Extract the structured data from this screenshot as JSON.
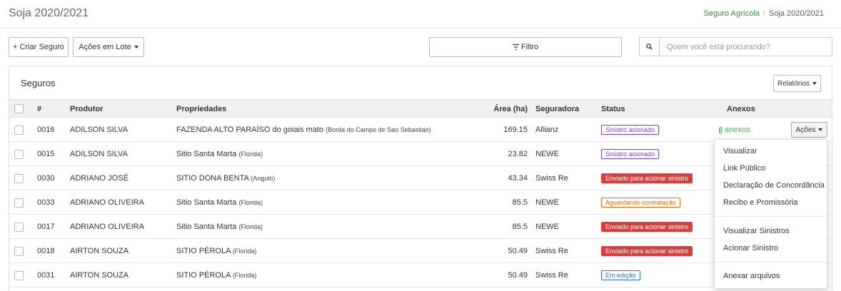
{
  "header": {
    "title": "Soja 2020/2021",
    "breadcrumb": {
      "link": "Seguro Agrícola",
      "separator": "/",
      "current": "Soja 2020/2021"
    }
  },
  "toolbar": {
    "create_label": "+ Criar Seguro",
    "bulk_label": "Ações em Lote",
    "filter_label": "Filtro",
    "search_placeholder": "Quem você está procurando?"
  },
  "panel": {
    "title": "Seguros",
    "reports_label": "Relatórios"
  },
  "table": {
    "columns": {
      "id": "#",
      "producer": "Produtor",
      "properties": "Propriedades",
      "area": "Área (ha)",
      "insurer": "Seguradora",
      "status": "Status",
      "attachments": "Anexos"
    },
    "rows": [
      {
        "id": "0016",
        "producer": "ADILSON SILVA",
        "property": "FAZENDA ALTO PARAÍSO do goiais mato",
        "property_sub": "(Borda do Campo de Sao Sebastiao)",
        "area": "169.15",
        "insurer": "Allianz",
        "status": "Sinistro acionado",
        "status_color": "#7b3fb6",
        "attachments": "anexos",
        "actions": "Ações"
      },
      {
        "id": "0015",
        "producer": "ADILSON SILVA",
        "property": "Sitio Santa Marta",
        "property_sub": "(Florida)",
        "area": "23.82",
        "insurer": "NEWE",
        "status": "Sinistro acionado",
        "status_color": "#7b3fb6"
      },
      {
        "id": "0030",
        "producer": "ADRIANO JOSÉ",
        "property": "SITIO DONA BENTA",
        "property_sub": "(Angulo)",
        "area": "43.34",
        "insurer": "Swiss Re",
        "status": "Enviado para acionar sinistro",
        "status_color": "#dc3c3c"
      },
      {
        "id": "0033",
        "producer": "ADRIANO OLIVEIRA",
        "property": "Sitio Santa Marta",
        "property_sub": "(Florida)",
        "area": "85.5",
        "insurer": "NEWE",
        "status": "Aguardando contratação",
        "status_color": "#e06c10"
      },
      {
        "id": "0017",
        "producer": "ADRIANO OLIVEIRA",
        "property": "Sitio Santa Marta",
        "property_sub": "(Florida)",
        "area": "85.5",
        "insurer": "NEWE",
        "status": "Enviado para acionar sinistro",
        "status_color": "#dc3c3c"
      },
      {
        "id": "0018",
        "producer": "AIRTON SOUZA",
        "property": "SITIO PÉROLA",
        "property_sub": "(Florida)",
        "area": "50.49",
        "insurer": "Swiss Re",
        "status": "Enviado para acionar sinistro",
        "status_color": "#dc3c3c"
      },
      {
        "id": "0031",
        "producer": "AIRTON SOUZA",
        "property": "SITIO PÉROLA",
        "property_sub": "(Florida)",
        "area": "50.49",
        "insurer": "Swiss Re",
        "status": "Em edição",
        "status_color": "#2a6fd1"
      }
    ]
  },
  "actions_menu": {
    "items": [
      "Visualizar",
      "Link Público",
      "Declaração de Concordância",
      "Recibo e Promissória",
      "Visualizar Sinistros",
      "Acionar Sinistro",
      "Anexar arquivos"
    ]
  },
  "icons": {
    "filter": "filter-icon",
    "search": "search-icon",
    "attachment": "paperclip-icon",
    "caret": "caret-down-icon"
  },
  "colors": {
    "accent_green": "#3c8c3c",
    "attachment_green": "#4caf50",
    "status_purple": "#7b3fb6",
    "status_red": "#dc3c3c",
    "status_orange": "#e06c10",
    "status_blue": "#2a6fd1"
  }
}
